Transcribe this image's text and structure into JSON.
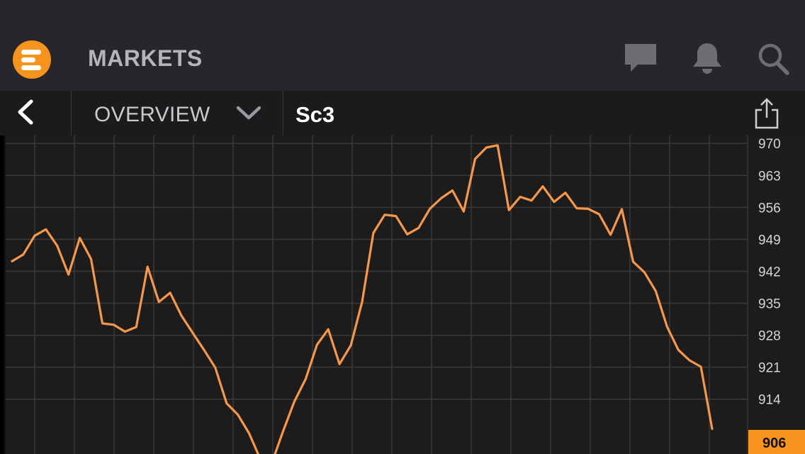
{
  "app": {
    "title": "MARKETS",
    "logo_icon": "menu-lines-icon",
    "accent_color": "#f7941d",
    "actions": [
      {
        "name": "chat-icon"
      },
      {
        "name": "bell-icon"
      },
      {
        "name": "search-icon"
      }
    ]
  },
  "subnav": {
    "back_icon": "chevron-left-icon",
    "view_label": "OVERVIEW",
    "view_icon": "chevron-down-icon",
    "instrument": "Sc3",
    "share_icon": "share-icon"
  },
  "chart_data": {
    "type": "line",
    "series": [
      {
        "color": "#f7974a",
        "values": [
          944.2,
          945.7,
          949.8,
          951.2,
          947.6,
          941.3,
          949.3,
          944.7,
          930.6,
          930.3,
          928.8,
          929.8,
          943.0,
          935.3,
          937.3,
          932.3,
          928.5,
          924.8,
          920.9,
          913.1,
          910.6,
          906.5,
          900.8,
          900.0,
          907.0,
          913.5,
          918.4,
          925.9,
          929.3,
          921.7,
          925.8,
          935.3,
          950.4,
          954.4,
          954.1,
          950.1,
          951.5,
          955.7,
          958.0,
          959.7,
          955.1,
          966.6,
          969.1,
          969.6,
          955.4,
          958.3,
          957.5,
          960.6,
          957.2,
          959.2,
          955.8,
          955.7,
          954.5,
          950.0,
          955.6,
          944.1,
          941.8,
          937.7,
          929.9,
          924.8,
          922.5,
          921.1,
          907.5
        ]
      }
    ],
    "y_ticks": [
      "970",
      "963",
      "956",
      "949",
      "942",
      "935",
      "928",
      "921",
      "914"
    ],
    "y_tick_values": [
      970,
      963,
      956,
      949,
      942,
      935,
      928,
      921,
      914
    ],
    "ylim": [
      902,
      970.5
    ],
    "last_price": "906",
    "grid": true,
    "axis_side": "right"
  }
}
